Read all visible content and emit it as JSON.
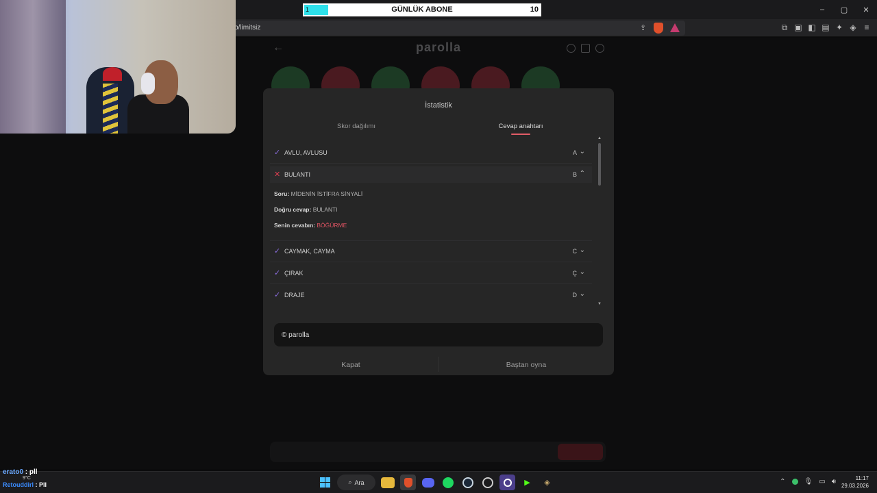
{
  "browser": {
    "url": "p/limitsiz",
    "window_controls": [
      "–",
      "▢",
      "✕"
    ],
    "toolbar_icons": [
      "extensions-icon",
      "screenshot-icon",
      "sidebar-icon",
      "wallet-icon",
      "leo-icon",
      "vpn-icon",
      "menu-icon"
    ]
  },
  "page": {
    "logo": "parolla",
    "answer_placeholder": "",
    "answer_button": "",
    "letters": [
      "",
      "",
      "",
      "",
      "",
      ""
    ],
    "letter_colors": [
      "#1c3a24",
      "#4a1a20",
      "#1c3a24",
      "#4a1a20",
      "#4a1a20",
      "#1c3a24"
    ]
  },
  "modal": {
    "title": "İstatistik",
    "tabs": [
      "Skor dağılımı",
      "Cevap anahtarı"
    ],
    "active_tab": 1,
    "items": [
      {
        "status": "correct",
        "label": "AVLU, AVLUSU",
        "letter": "A",
        "expanded": false
      },
      {
        "status": "wrong",
        "label": "BULANTI",
        "letter": "B",
        "expanded": true
      },
      {
        "status": "correct",
        "label": "CAYMAK, CAYMA",
        "letter": "C",
        "expanded": false
      },
      {
        "status": "correct",
        "label": "ÇIRAK",
        "letter": "Ç",
        "expanded": false
      },
      {
        "status": "correct",
        "label": "DRAJE",
        "letter": "D",
        "expanded": false
      }
    ],
    "detail": {
      "question_label": "Soru:",
      "question": "MİDENİN İSTİFRA SİNYALİ",
      "correct_label": "Doğru cevap:",
      "correct": "BULANTI",
      "yours_label": "Senin cevabın:",
      "yours": "BÖĞÜRME"
    },
    "footer": "© parolla",
    "close_button": "Kapat",
    "restart_button": "Baştan oyna"
  },
  "overlay": {
    "sub_goal_label": "GÜNLÜK ABONE",
    "sub_current": "1",
    "sub_target": "10",
    "sub_progress": 0.1,
    "chat": [
      {
        "user": "erato0",
        "text": ": pll"
      },
      {
        "user": "Retouddirl",
        "text": ": Pll"
      }
    ],
    "weather": "9°C"
  },
  "taskbar": {
    "search_label": "Ara",
    "time": "11:17",
    "date": "29.03.2026"
  },
  "colors": {
    "accent_correct": "#8b6ee0",
    "accent_wrong": "#e03f52",
    "tab_underline": "#e25c67",
    "sub_bar_fill": "#2ee0ea"
  }
}
